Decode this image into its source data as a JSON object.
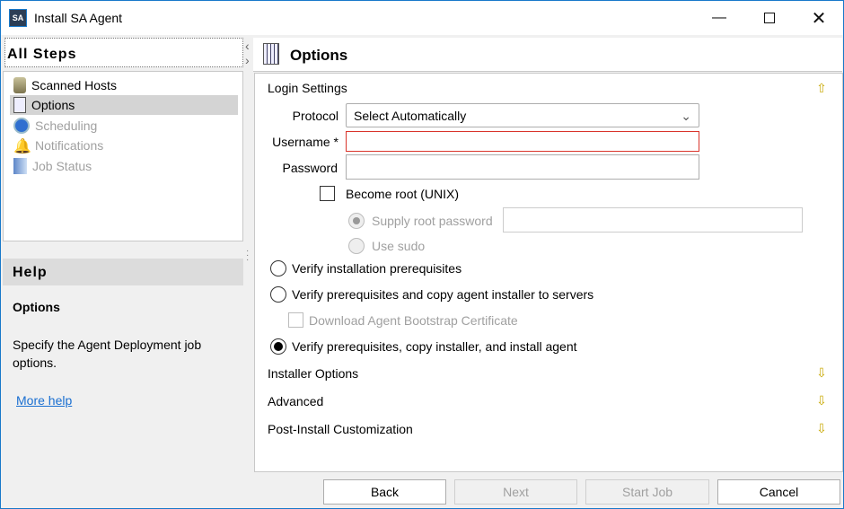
{
  "window": {
    "title": "Install SA Agent",
    "logo": "SA"
  },
  "steps": {
    "header": "All Steps",
    "items": [
      {
        "label": "Scanned Hosts",
        "icon": "server-icon",
        "state": "done"
      },
      {
        "label": "Options",
        "icon": "options-icon",
        "state": "selected"
      },
      {
        "label": "Scheduling",
        "icon": "clock-icon",
        "state": "disabled"
      },
      {
        "label": "Notifications",
        "icon": "bell-icon",
        "state": "disabled"
      },
      {
        "label": "Job Status",
        "icon": "job-status-icon",
        "state": "disabled"
      }
    ]
  },
  "help": {
    "header": "Help",
    "title": "Options",
    "text": "Specify the Agent Deployment job options.",
    "link": "More help"
  },
  "main": {
    "title": "Options",
    "login": {
      "section": "Login Settings",
      "protocol_label": "Protocol",
      "protocol_value": "Select Automatically",
      "username_label": "Username *",
      "username_value": "",
      "password_label": "Password",
      "password_value": "",
      "become_root": "Become root (UNIX)",
      "supply_root": "Supply root password",
      "use_sudo": "Use sudo"
    },
    "options": {
      "verify": "Verify installation prerequisites",
      "verify_copy": "Verify prerequisites and copy agent installer to servers",
      "download_cert": "Download Agent Bootstrap Certificate",
      "verify_install": "Verify prerequisites, copy installer, and install agent",
      "selected": "verify_install"
    },
    "sections": [
      "Installer Options",
      "Advanced",
      "Post-Install Customization"
    ]
  },
  "buttons": {
    "back": "Back",
    "next": "Next",
    "start": "Start Job",
    "cancel": "Cancel"
  },
  "colors": {
    "accent": "#1979ca",
    "error_border": "#d9342b",
    "selection": "#d4d4d4"
  }
}
